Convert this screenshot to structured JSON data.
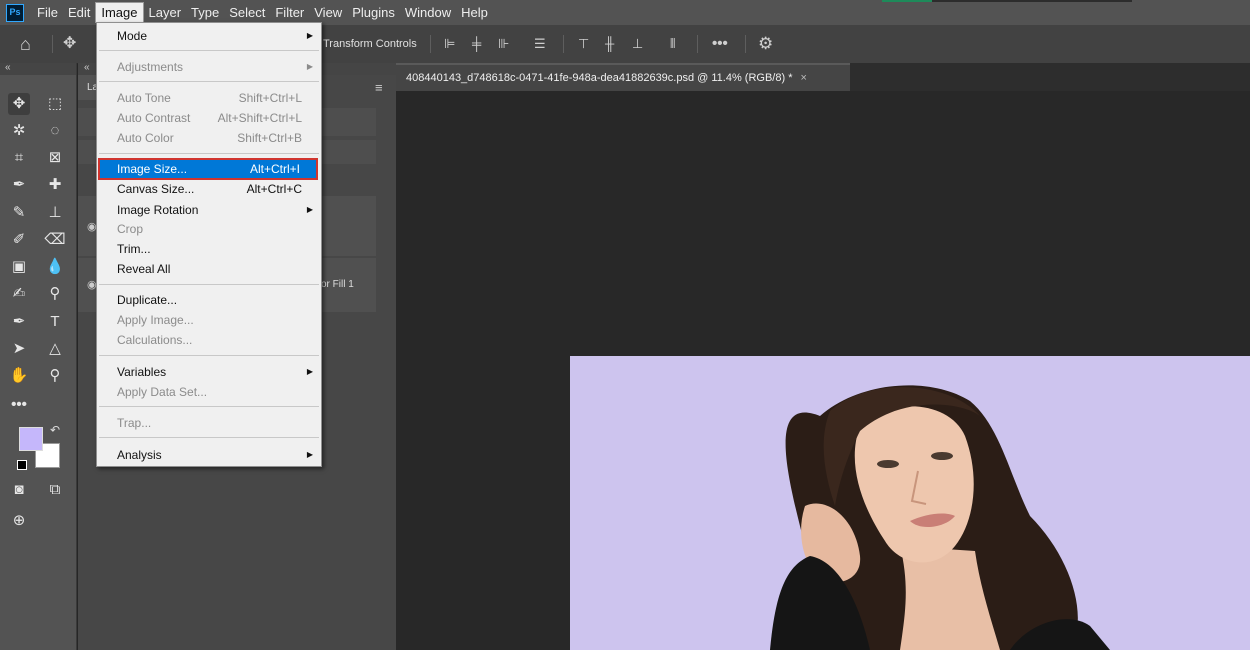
{
  "menubar": {
    "logo": "Ps",
    "items": [
      "File",
      "Edit",
      "Image",
      "Layer",
      "Type",
      "Select",
      "Filter",
      "View",
      "Plugins",
      "Window",
      "Help"
    ]
  },
  "options_bar": {
    "transform_controls_label": "Transform Controls"
  },
  "toolbar": {
    "collapse_label": "«",
    "foreground_color": "#c5b7fb",
    "background_color": "#ffffff"
  },
  "panels": {
    "collapse_label": "«",
    "layers_tab_partial": "La",
    "partial_layer_name": "or Fill 1"
  },
  "document": {
    "tab_title": "408440143_d748618c-0471-41fe-948a-dea41882639c.psd @ 11.4% (RGB/8) *",
    "close_glyph": "×",
    "canvas_color": "#cdc4ee"
  },
  "image_menu": {
    "mode": "Mode",
    "adjustments": "Adjustments",
    "auto_tone": "Auto Tone",
    "auto_tone_sc": "Shift+Ctrl+L",
    "auto_contrast": "Auto Contrast",
    "auto_contrast_sc": "Alt+Shift+Ctrl+L",
    "auto_color": "Auto Color",
    "auto_color_sc": "Shift+Ctrl+B",
    "image_size": "Image Size...",
    "image_size_sc": "Alt+Ctrl+I",
    "canvas_size": "Canvas Size...",
    "canvas_size_sc": "Alt+Ctrl+C",
    "image_rotation": "Image Rotation",
    "crop": "Crop",
    "trim": "Trim...",
    "reveal_all": "Reveal All",
    "duplicate": "Duplicate...",
    "apply_image": "Apply Image...",
    "calculations": "Calculations...",
    "variables": "Variables",
    "apply_data_set": "Apply Data Set...",
    "trap": "Trap...",
    "analysis": "Analysis"
  }
}
